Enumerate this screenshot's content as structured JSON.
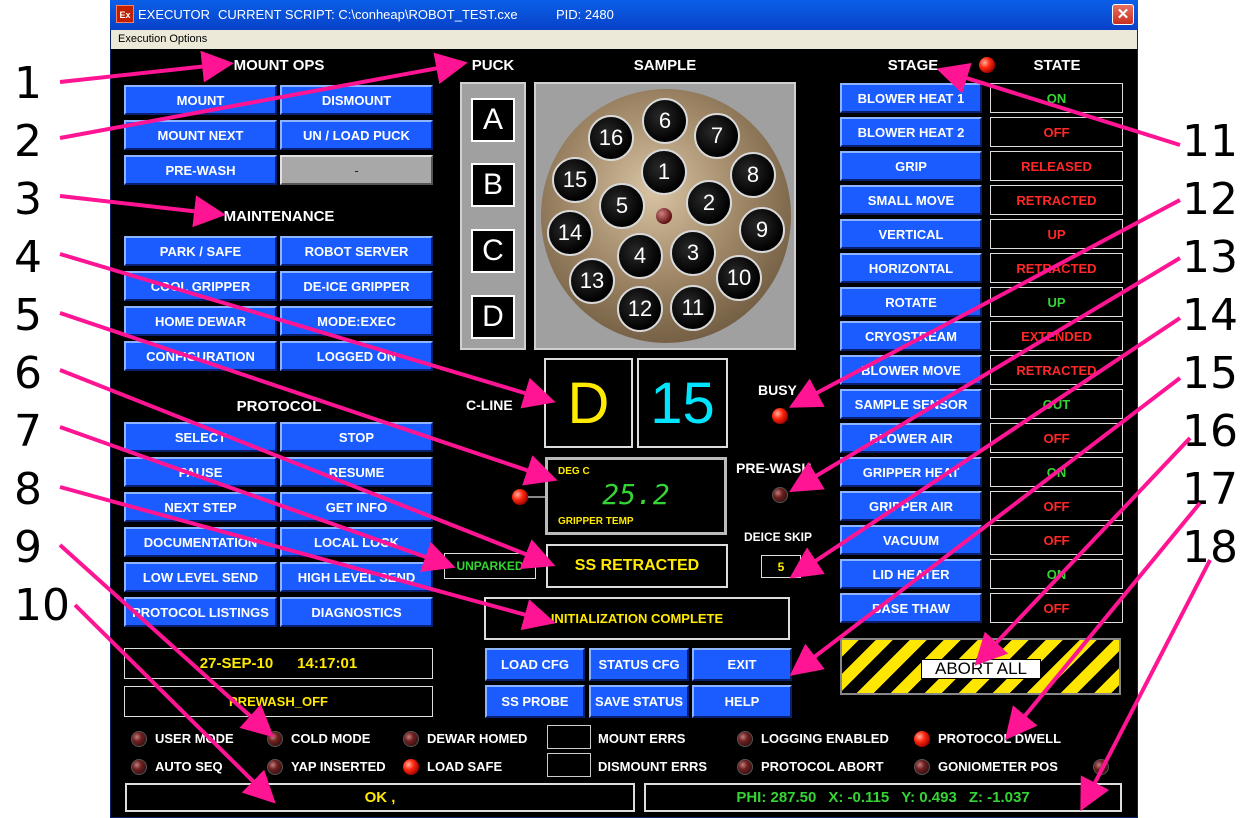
{
  "window": {
    "app_name": "EXECUTOR",
    "script_label": "CURRENT SCRIPT: C:\\conheap\\ROBOT_TEST.cxe",
    "pid_label": "PID: 2480",
    "app_icon": "Ex",
    "close_glyph": "✕"
  },
  "menu": {
    "execution_options": "Execution Options"
  },
  "mount_ops": {
    "header": "MOUNT OPS",
    "buttons": [
      "MOUNT",
      "DISMOUNT",
      "MOUNT NEXT",
      "UN / LOAD PUCK",
      "PRE-WASH",
      "-"
    ]
  },
  "maintenance": {
    "header": "MAINTENANCE",
    "buttons": [
      "PARK / SAFE",
      "ROBOT SERVER",
      "COOL GRIPPER",
      "DE-ICE GRIPPER",
      "HOME DEWAR",
      "MODE:EXEC",
      "CONFIGURATION",
      "LOGGED ON"
    ]
  },
  "protocol": {
    "header": "PROTOCOL",
    "buttons": [
      "SELECT",
      "STOP",
      "PAUSE",
      "RESUME",
      "NEXT STEP",
      "GET INFO",
      "DOCUMENTATION",
      "LOCAL LOCK",
      "LOW LEVEL SEND",
      "HIGH LEVEL SEND",
      "PROTOCOL LISTINGS",
      "DIAGNOSTICS"
    ]
  },
  "datetime": {
    "date": "27-SEP-10",
    "time": "14:17:01"
  },
  "prewash_status": "PREWASH_OFF",
  "puck": {
    "header": "PUCK",
    "buttons": [
      "A",
      "B",
      "C",
      "D"
    ]
  },
  "sample": {
    "header": "SAMPLE",
    "slots": [
      "16",
      "6",
      "7",
      "1",
      "8",
      "15",
      "5",
      "2",
      "14",
      "9",
      "4",
      "3",
      "13",
      "10",
      "12",
      "11"
    ]
  },
  "cline": {
    "label": "C-LINE",
    "puck": "D",
    "sample": "15"
  },
  "temperature": {
    "unit": "DEG C",
    "value": "25.2",
    "caption": "GRIPPER TEMP"
  },
  "parked_status": "UNPARKED",
  "ss_status": "SS RETRACTED",
  "busy_label": "BUSY",
  "prewash_label": "PRE-WASH",
  "deice": {
    "label": "DEICE SKIP",
    "value": "5"
  },
  "init_status": "INITIALIZATION COMPLETE",
  "actions": [
    "LOAD CFG",
    "STATUS CFG",
    "EXIT",
    "SS PROBE",
    "SAVE STATUS",
    "HELP"
  ],
  "stage": {
    "header": "STAGE",
    "state_header": "STATE",
    "rows": [
      {
        "name": "BLOWER HEAT 1",
        "state": "ON",
        "color": "#35d435"
      },
      {
        "name": "BLOWER HEAT 2",
        "state": "OFF",
        "color": "#ff2828"
      },
      {
        "name": "GRIP",
        "state": "RELEASED",
        "color": "#ff2828"
      },
      {
        "name": "SMALL MOVE",
        "state": "RETRACTED",
        "color": "#ff2828"
      },
      {
        "name": "VERTICAL",
        "state": "UP",
        "color": "#ff2828"
      },
      {
        "name": "HORIZONTAL",
        "state": "RETRACTED",
        "color": "#ff2828"
      },
      {
        "name": "ROTATE",
        "state": "UP",
        "color": "#35d435"
      },
      {
        "name": "CRYOSTREAM",
        "state": "EXTENDED",
        "color": "#ff2828"
      },
      {
        "name": "BLOWER MOVE",
        "state": "RETRACTED",
        "color": "#ff2828"
      },
      {
        "name": "SAMPLE SENSOR",
        "state": "OUT",
        "color": "#35d435"
      },
      {
        "name": "BLOWER AIR",
        "state": "OFF",
        "color": "#ff2828"
      },
      {
        "name": "GRIPPER HEAT",
        "state": "ON",
        "color": "#35d435"
      },
      {
        "name": "GRIPPER AIR",
        "state": "OFF",
        "color": "#ff2828"
      },
      {
        "name": "VACUUM",
        "state": "OFF",
        "color": "#ff2828"
      },
      {
        "name": "LID HEATER",
        "state": "ON",
        "color": "#35d435"
      },
      {
        "name": "BASE THAW",
        "state": "OFF",
        "color": "#ff2828"
      }
    ]
  },
  "abort_label": "ABORT ALL",
  "indicators": [
    {
      "label": "USER MODE",
      "on": false
    },
    {
      "label": "COLD MODE",
      "on": false
    },
    {
      "label": "DEWAR HOMED",
      "on": false
    },
    {
      "label": "LOGGING ENABLED",
      "on": false
    },
    {
      "label": "PROTOCOL DWELL",
      "on": true
    },
    {
      "label": "AUTO SEQ",
      "on": false
    },
    {
      "label": "YAP INSERTED",
      "on": false
    },
    {
      "label": "LOAD SAFE",
      "on": true
    },
    {
      "label": "PROTOCOL ABORT",
      "on": false
    },
    {
      "label": "GONIOMETER POS",
      "on": false
    }
  ],
  "mount_errs_label": "MOUNT ERRS",
  "dismount_errs_label": "DISMOUNT ERRS",
  "ok_status": "OK ,",
  "position": {
    "phi": "PHI:  287.50",
    "x": "X: -0.115",
    "y": "Y: 0.493",
    "z": "Z: -1.037"
  },
  "callouts": [
    "1",
    "2",
    "3",
    "4",
    "5",
    "6",
    "7",
    "8",
    "9",
    "10",
    "11",
    "12",
    "13",
    "14",
    "15",
    "16",
    "17",
    "18"
  ],
  "colors": {
    "accent_button": "#1a5cff",
    "led_red": "#ff2a10",
    "annotation_pink": "#ff1493",
    "status_yellow": "#ffea00",
    "status_green": "#35d435"
  }
}
